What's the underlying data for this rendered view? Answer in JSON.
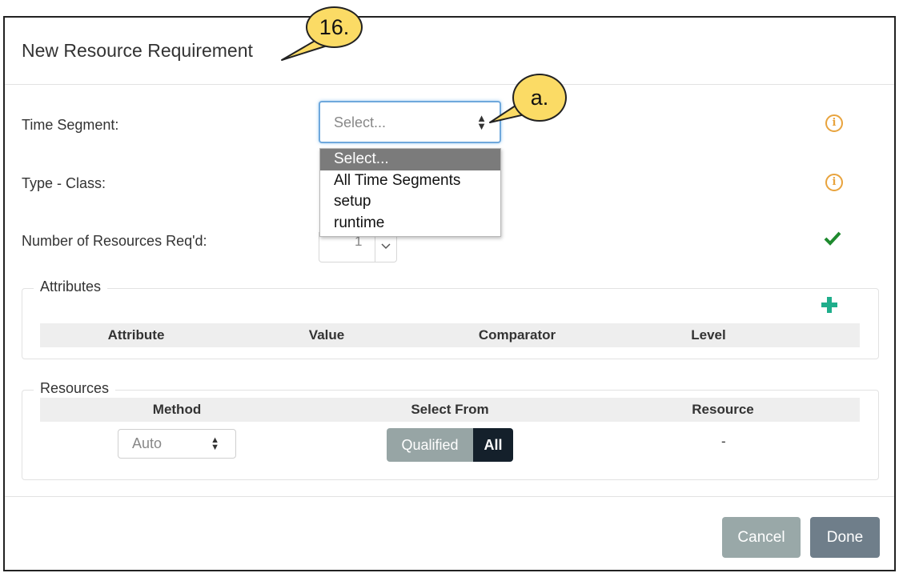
{
  "dialog": {
    "title": "New Resource Requirement"
  },
  "form": {
    "time_segment_label": "Time Segment:",
    "type_class_label": "Type - Class:",
    "num_resources_label": "Number of Resources Req'd:",
    "time_segment_select": {
      "value": "Select...",
      "options": [
        "Select...",
        "All Time Segments",
        "setup",
        "runtime"
      ],
      "selected_index": 0
    },
    "num_resources_value": "1"
  },
  "attributes": {
    "legend": "Attributes",
    "columns": [
      "Attribute",
      "Value",
      "Comparator",
      "Level"
    ]
  },
  "resources": {
    "legend": "Resources",
    "columns": [
      "Method",
      "Select From",
      "Resource"
    ],
    "method_value": "Auto",
    "select_from_options": [
      "Qualified",
      "All"
    ],
    "select_from_active": "All",
    "resource_value": "-"
  },
  "footer": {
    "cancel_label": "Cancel",
    "done_label": "Done"
  },
  "callouts": {
    "step": "16.",
    "sub_step": "a."
  },
  "icons": {
    "info": "info-circle-icon",
    "check": "check-icon",
    "plus": "plus-icon",
    "select_arrows": "sort-arrows-icon",
    "chevron": "chevron-down-icon"
  },
  "colors": {
    "info": "#e8a33d",
    "check": "#1e8a2e",
    "plus": "#1fae8b",
    "callout": "#fbdb65",
    "toggle_active": "#14202b",
    "toggle_inactive": "#97a5a5",
    "cancel_button": "#99a8a8",
    "done_button": "#6f7e8a",
    "dropdown_highlight": "#7b7b7b"
  }
}
